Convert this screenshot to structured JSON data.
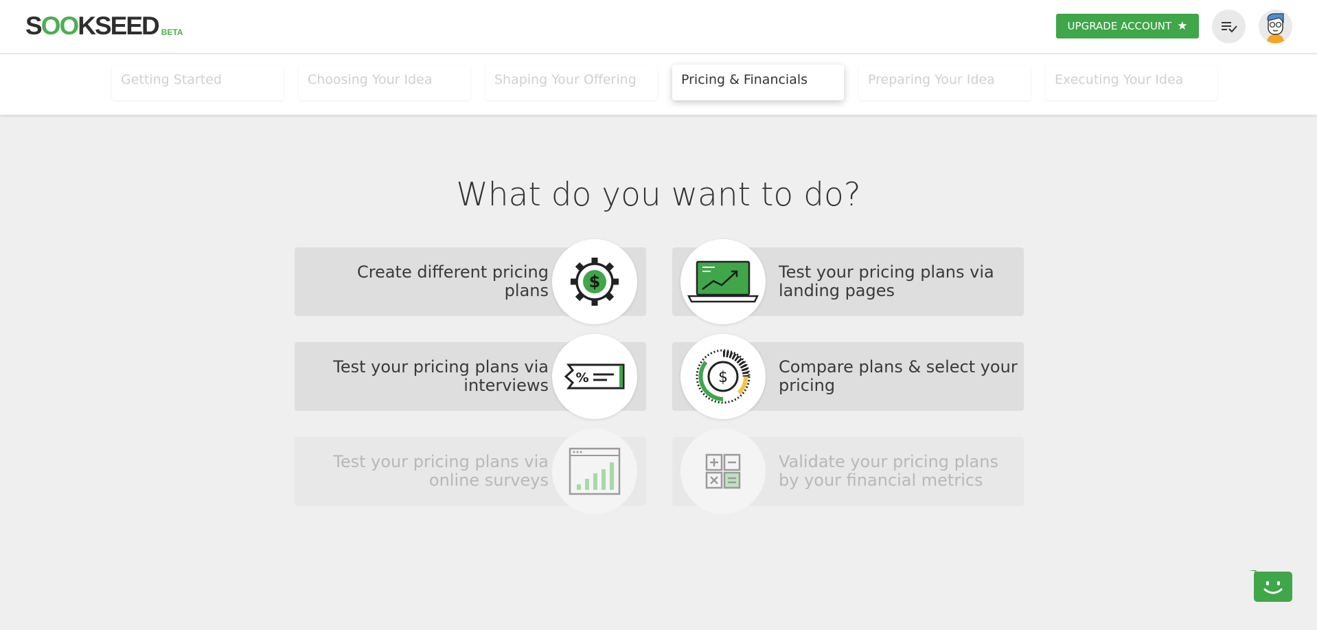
{
  "header": {
    "logo_prefix": "S",
    "logo_oo": "OO",
    "logo_suffix": "KSEED",
    "logo_badge": "BETA",
    "upgrade_label": "UPGRADE ACCOUNT",
    "upgrade_icon": "star-icon",
    "tasks_icon": "task-list-icon",
    "avatar_icon": "user-avatar"
  },
  "steps": [
    {
      "label": "Getting Started",
      "active": false
    },
    {
      "label": "Choosing Your Idea",
      "active": false
    },
    {
      "label": "Shaping Your Offering",
      "active": false
    },
    {
      "label": "Pricing & Financials",
      "active": true
    },
    {
      "label": "Preparing Your Idea",
      "active": false
    },
    {
      "label": "Executing Your Idea",
      "active": false
    }
  ],
  "main": {
    "title": "What do you want to do?",
    "options": [
      {
        "label": "Create different pricing plans",
        "icon": "gear-dollar-icon",
        "enabled": true
      },
      {
        "label": "Test your pricing plans via landing pages",
        "icon": "laptop-chart-icon",
        "enabled": true
      },
      {
        "label": "Test your pricing plans via interviews",
        "icon": "price-tag-icon",
        "enabled": true
      },
      {
        "label": "Compare plans & select your pricing",
        "icon": "dollar-gauge-icon",
        "enabled": true
      },
      {
        "label": "Test your pricing plans via online surveys",
        "icon": "browser-chart-icon",
        "enabled": false
      },
      {
        "label": "Validate your pricing plans by your financial metrics",
        "icon": "calculator-icon",
        "enabled": false
      }
    ]
  },
  "colors": {
    "accent": "#3fa649",
    "background": "#efefef",
    "card": "#dedede"
  },
  "chat": {
    "icon": "chat-bot-icon"
  }
}
